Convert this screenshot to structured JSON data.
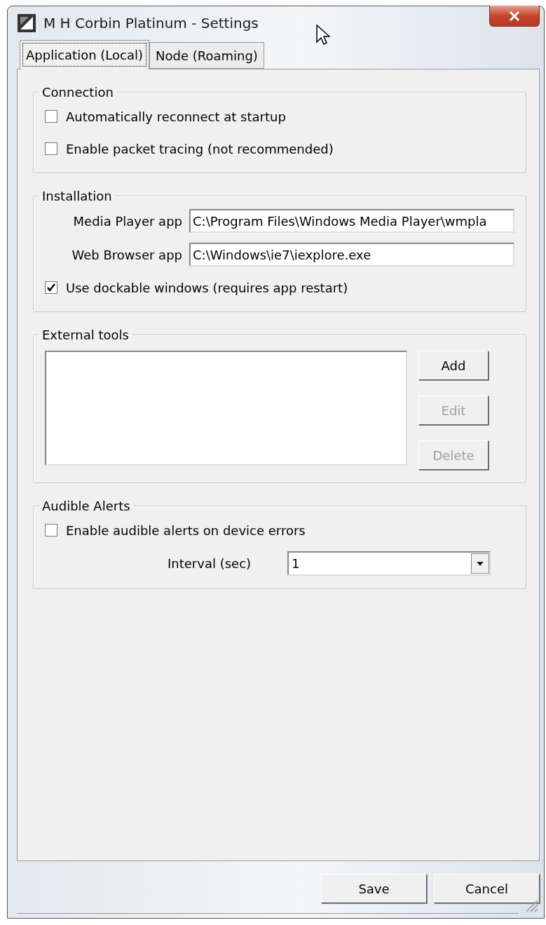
{
  "window": {
    "title": "M H Corbin Platinum - Settings"
  },
  "tabs": [
    {
      "label": "Application (Local)",
      "selected": true
    },
    {
      "label": "Node (Roaming)",
      "selected": false
    }
  ],
  "connection": {
    "title": "Connection",
    "options": [
      {
        "label": "Automatically reconnect at startup",
        "checked": false
      },
      {
        "label": "Enable packet tracing (not recommended)",
        "checked": false
      }
    ]
  },
  "installation": {
    "title": "Installation",
    "fields": [
      {
        "label": "Media Player app",
        "value": "C:\\Program Files\\Windows Media Player\\wmpla"
      },
      {
        "label": "Web Browser app",
        "value": "C:\\Windows\\ie7\\iexplore.exe"
      }
    ],
    "options": [
      {
        "label": "Use dockable windows (requires app restart)",
        "checked": true
      }
    ]
  },
  "external_tools": {
    "title": "External tools",
    "buttons": [
      {
        "label": "Add",
        "disabled": false
      },
      {
        "label": "Edit",
        "disabled": true
      },
      {
        "label": "Delete",
        "disabled": true
      }
    ]
  },
  "audible_alerts": {
    "title": "Audible Alerts",
    "options": [
      {
        "label": "Enable audible alerts on device errors",
        "checked": false
      }
    ],
    "interval": {
      "label": "Interval (sec)",
      "value": "1"
    }
  },
  "buttons": [
    "Save",
    "Cancel"
  ]
}
